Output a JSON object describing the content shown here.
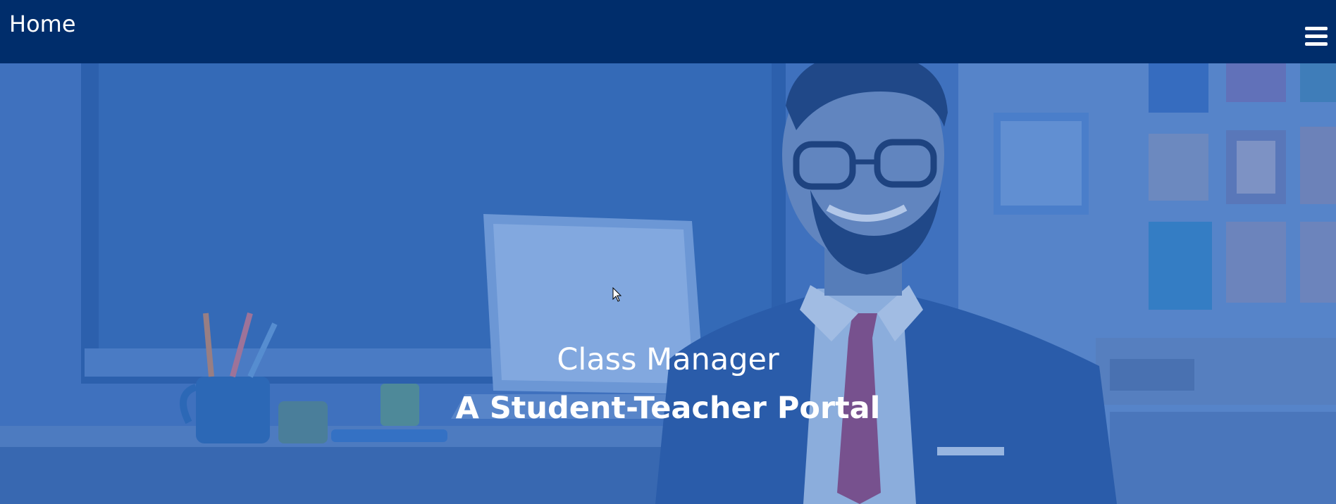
{
  "navbar": {
    "title": "Home",
    "menu_icon": "hamburger-menu-icon"
  },
  "hero": {
    "title": "Class Manager",
    "subtitle": "A Student-Teacher Portal",
    "background_image": "teacher-classroom-illustration"
  },
  "colors": {
    "navbar_bg": "#002d6b",
    "hero_tint": "#2d64b4",
    "text": "#ffffff"
  }
}
